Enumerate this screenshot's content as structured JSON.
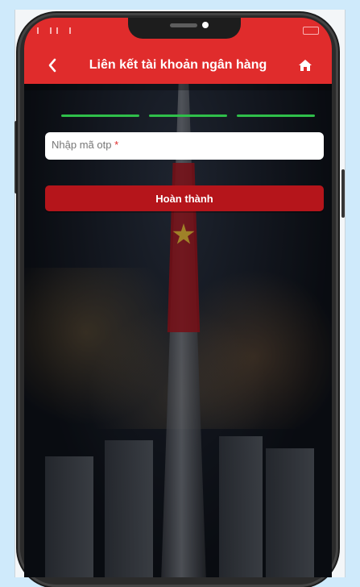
{
  "header": {
    "title": "Liên kết tài khoản ngân hàng",
    "back_icon": "chevron-left-icon",
    "home_icon": "home-icon",
    "color": "#e02c2c"
  },
  "form": {
    "otp_placeholder": "Nhập mã otp",
    "required_mark": "*",
    "submit_label": "Hoàn thành",
    "button_color": "#b5151b"
  },
  "progress": {
    "steps_total": 3,
    "steps_completed": 3,
    "color": "#2fbf4a"
  }
}
